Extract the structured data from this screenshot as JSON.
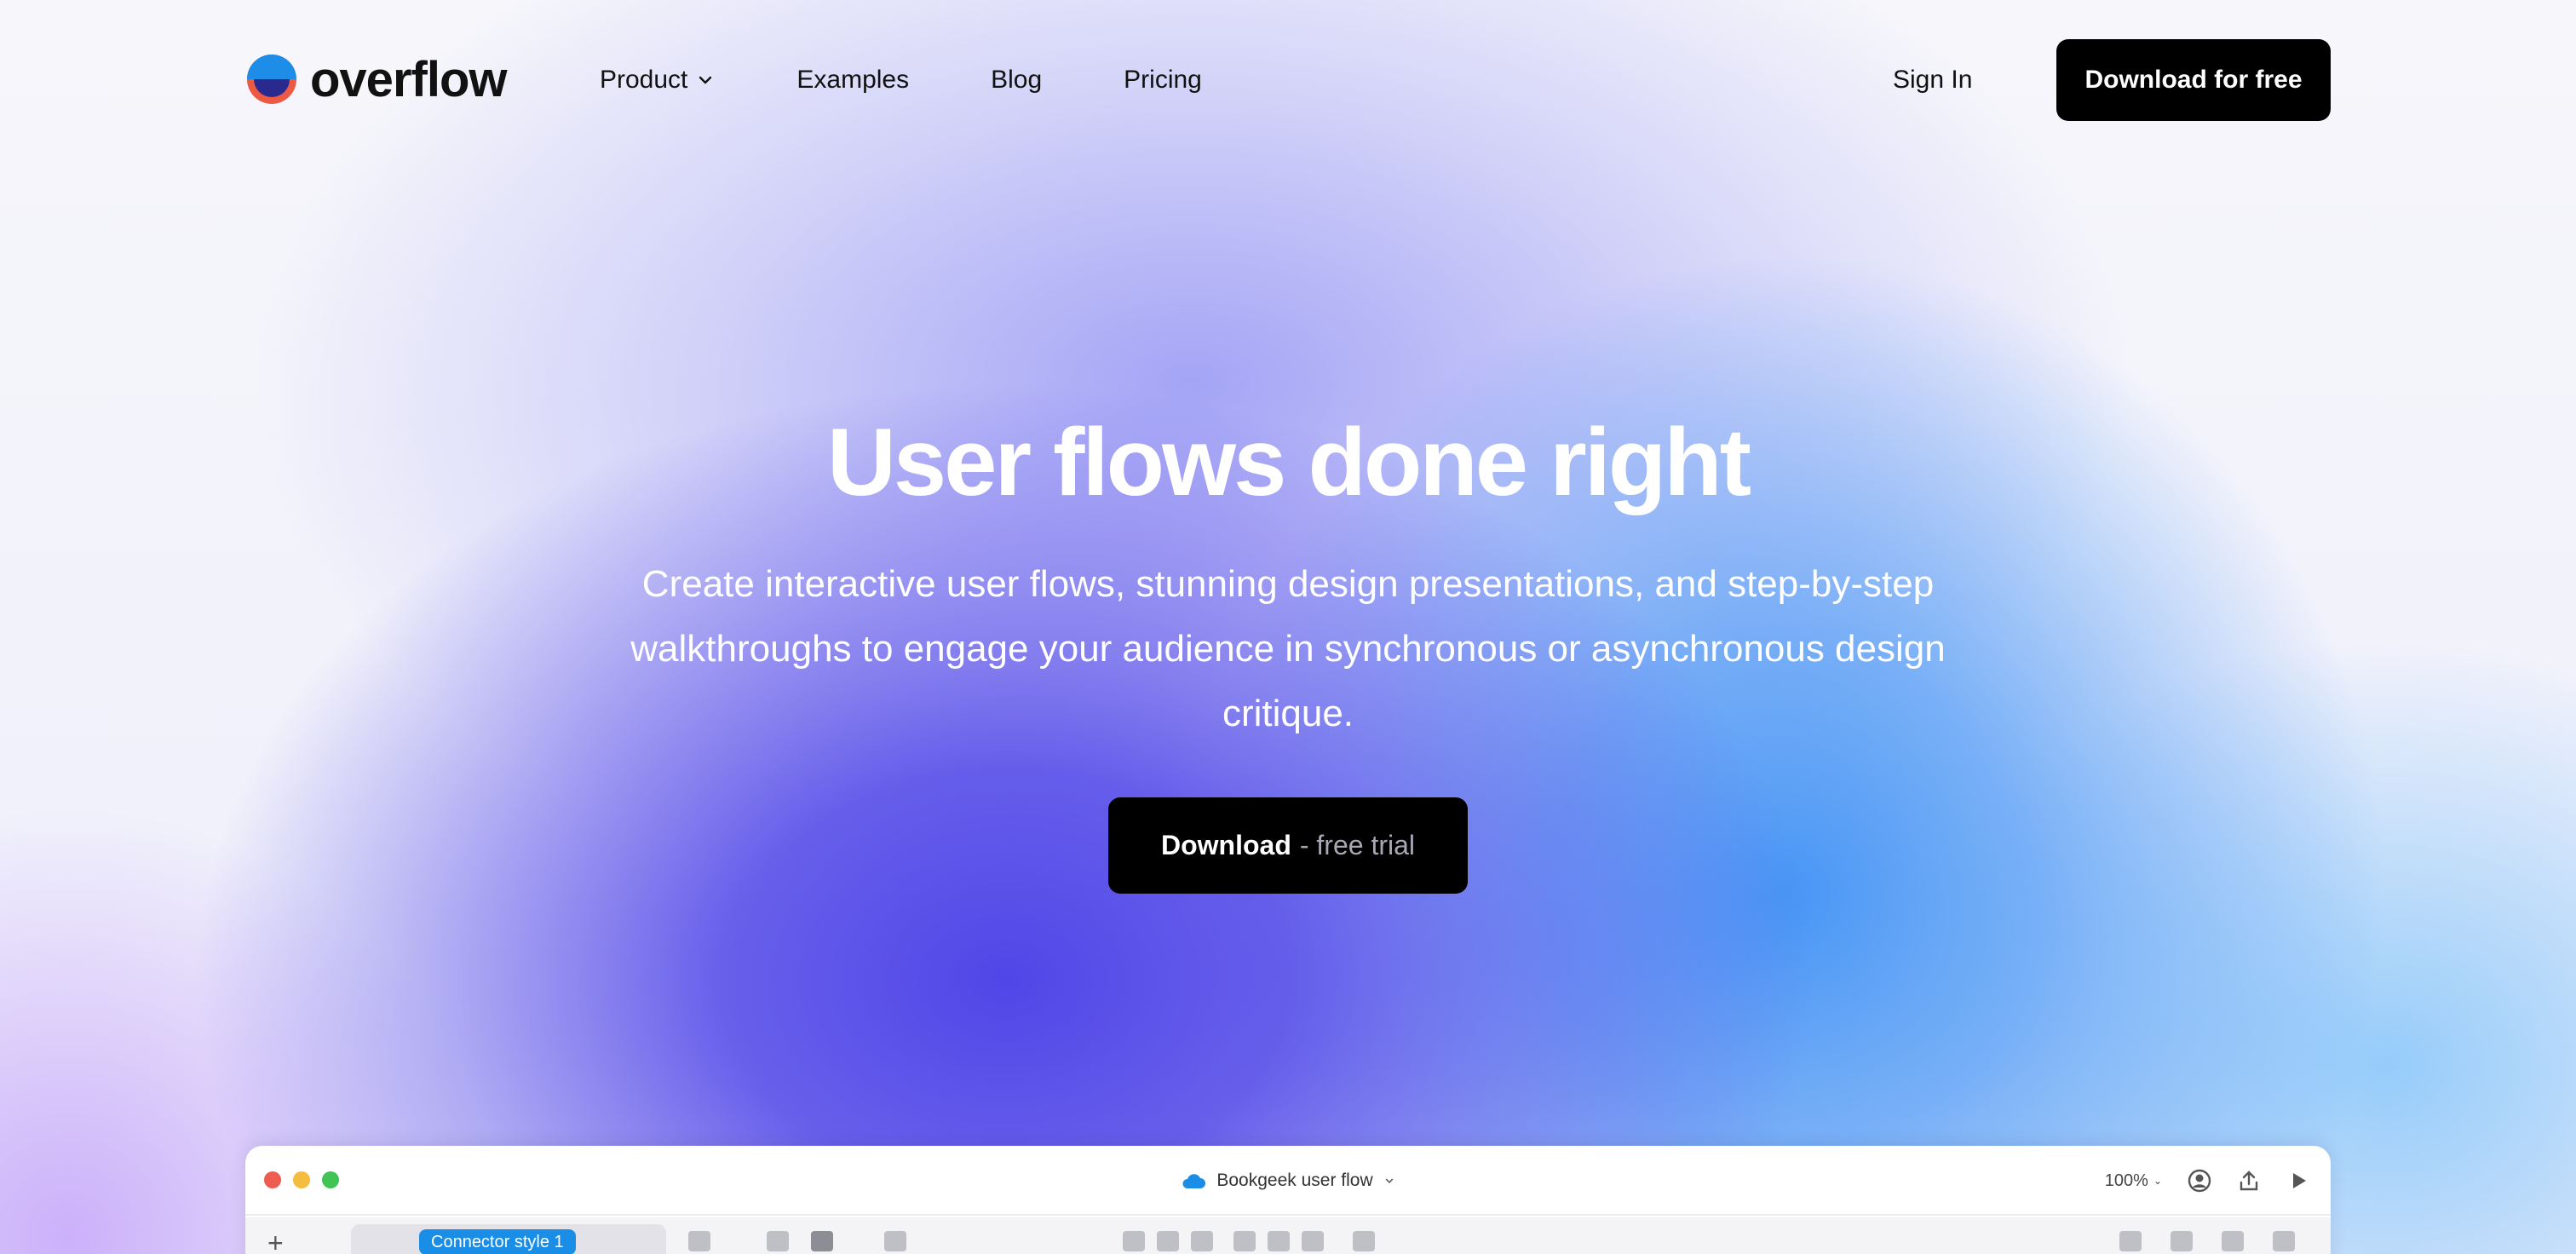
{
  "nav": {
    "logo_text": "overflow",
    "links": [
      {
        "label": "Product",
        "has_dropdown": true
      },
      {
        "label": "Examples"
      },
      {
        "label": "Blog"
      },
      {
        "label": "Pricing"
      }
    ],
    "sign_in": "Sign In",
    "cta": "Download for free"
  },
  "hero": {
    "title": "User flows done right",
    "subtitle": "Create interactive user flows, stunning design presentations, and step-by-step walkthroughs to engage your audience in synchronous or asynchronous design critique.",
    "cta_strong": "Download",
    "cta_light": "- free trial"
  },
  "app_preview": {
    "doc_title": "Bookgeek user flow",
    "zoom": "100%",
    "connector_style": "Connector style 1"
  },
  "colors": {
    "logo_top": "#1d8de8",
    "logo_bottom": "#ec5a45",
    "logo_inner": "#2a2a8e",
    "hero_purple": "#5046e8",
    "hero_blue": "#4896f5",
    "button_black": "#000000"
  },
  "icons": [
    "chevron-down-icon",
    "cloud-icon",
    "user-icon",
    "share-icon",
    "play-icon",
    "plus-icon"
  ]
}
